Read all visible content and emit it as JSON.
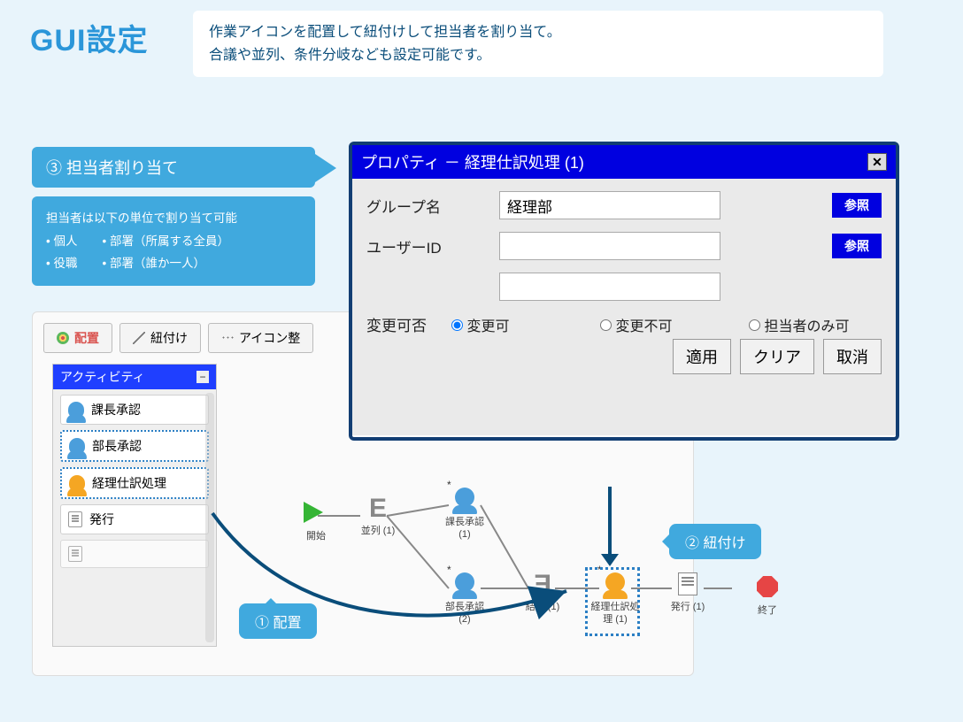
{
  "page_title": "GUI設定",
  "description_line1": "作業アイコンを配置して紐付けして担当者を割り当て。",
  "description_line2": "合議や並列、条件分岐なども設定可能です。",
  "callout3": {
    "head": "③ 担当者割り当て",
    "body_intro": "担当者は以下の単位で割り当て可能",
    "ul1a": "個人",
    "ul1b": "部署（所属する全員）",
    "ul2a": "役職",
    "ul2b": "部署（誰か一人）"
  },
  "toolbar": {
    "place": "配置",
    "link": "紐付け",
    "icon_align": "アイコン整"
  },
  "palette": {
    "title": "アクティビティ",
    "items": [
      {
        "label": "課長承認",
        "kind": "user-blue"
      },
      {
        "label": "部長承認",
        "kind": "user-blue"
      },
      {
        "label": "経理仕訳処理",
        "kind": "user-orange"
      },
      {
        "label": "発行",
        "kind": "doc"
      },
      {
        "label": "",
        "kind": "doc"
      }
    ]
  },
  "nodes": {
    "start": "開始",
    "parallel": "並列 (1)",
    "kacho": "課長承認 (1)",
    "bucho": "部長承認 (2)",
    "join": "結合 (1)",
    "keiri": "経理仕訳処理 (1)",
    "issue": "発行 (1)",
    "end": "終了"
  },
  "bubble1": "① 配置",
  "bubble2": "② 紐付け",
  "property": {
    "title": "プロパティ － 経理仕訳処理 (1)",
    "group_label": "グループ名",
    "group_value": "経理部",
    "user_label": "ユーザーID",
    "user_value": "",
    "extra_value": "",
    "ref_btn": "参照",
    "change_label": "変更可否",
    "radio1": "変更可",
    "radio2": "変更不可",
    "radio3": "担当者のみ可",
    "btn_apply": "適用",
    "btn_clear": "クリア",
    "btn_cancel": "取消"
  }
}
